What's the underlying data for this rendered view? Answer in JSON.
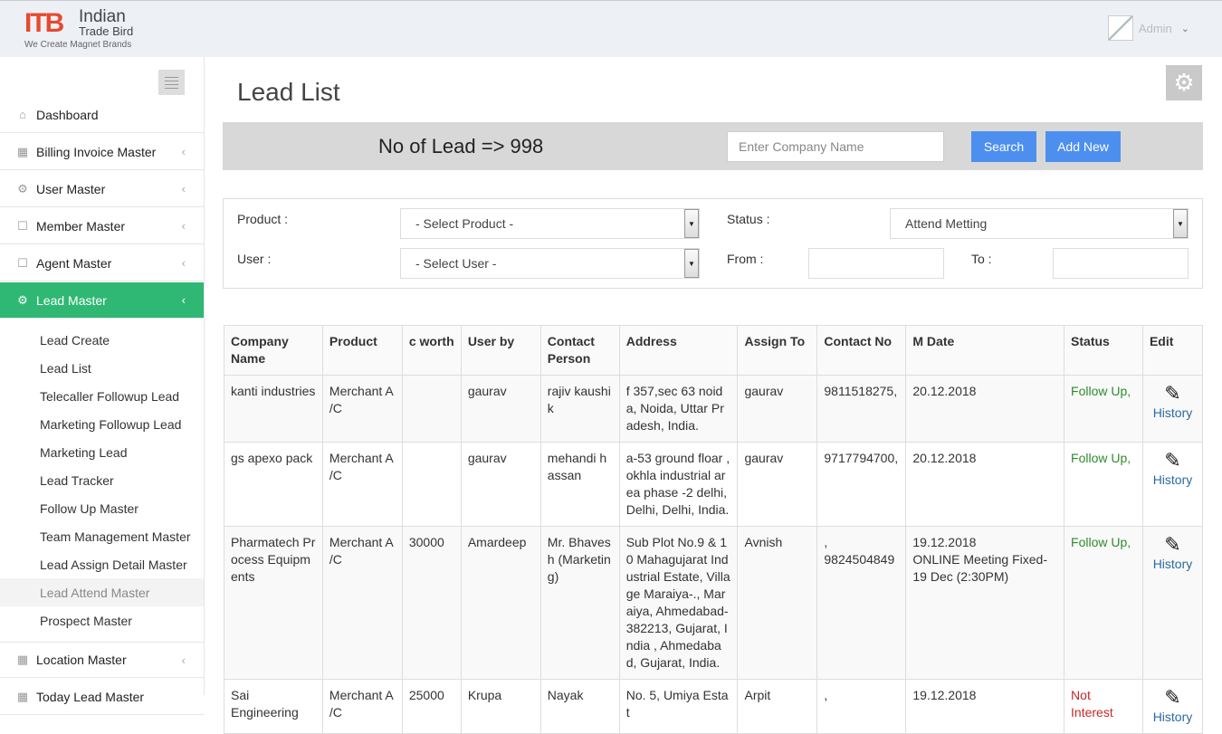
{
  "brand": {
    "mark": "ITB",
    "name": "Indian",
    "name2": "Trade Bird",
    "tagline": "We Create Magnet Brands"
  },
  "user": {
    "name": "Admin"
  },
  "sidebar": {
    "items": [
      {
        "label": "Dashboard",
        "icon": "home-icon"
      },
      {
        "label": "Billing Invoice Master",
        "icon": "table-icon"
      },
      {
        "label": "User Master",
        "icon": "cogs-icon"
      },
      {
        "label": "Member Master",
        "icon": "bookmark-icon"
      },
      {
        "label": "Agent Master",
        "icon": "bookmark-icon"
      },
      {
        "label": "Lead Master",
        "icon": "cogs-icon"
      },
      {
        "label": "Location Master",
        "icon": "table-icon"
      },
      {
        "label": "Today Lead Master",
        "icon": "table-icon"
      }
    ],
    "lead_sub": [
      "Lead Create",
      "Lead List",
      "Telecaller Followup Lead",
      "Marketing Followup Lead",
      "Marketing Lead",
      "Lead Tracker",
      "Follow Up Master",
      "Team Management Master",
      "Lead Assign Detail Master",
      "Lead Attend Master",
      "Prospect Master"
    ]
  },
  "page": {
    "title": "Lead List"
  },
  "leadbar": {
    "count_text": "No of Lead => 998",
    "search_placeholder": "Enter Company Name",
    "search_label": "Search",
    "add_label": "Add New"
  },
  "filters": {
    "product_label": "Product :",
    "product_value": "- Select Product -",
    "status_label": "Status :",
    "status_value": "Attend Metting",
    "user_label": "User :",
    "user_value": "- Select User -",
    "from_label": "From :",
    "to_label": "To :"
  },
  "table": {
    "headers": [
      "Company Name",
      "Product",
      "c worth",
      "User by",
      "Contact Person",
      "Address",
      "Assign To",
      "Contact No",
      "M Date",
      "Status",
      "Edit"
    ],
    "rows": [
      {
        "company": "kanti industries",
        "product": "Merchant A /C",
        "worth": "",
        "user": "gaurav",
        "contact": "rajiv kaushik",
        "address": "f 357,sec 63 noida, Noida, Uttar Pradesh, India.",
        "assign": "gaurav",
        "phone": "9811518275,",
        "mdate": "20.12.2018",
        "mnote": "",
        "status": "Follow Up,",
        "history": "History"
      },
      {
        "company": "gs apexo pack",
        "product": "Merchant A /C",
        "worth": "",
        "user": "gaurav",
        "contact": "mehandi hassan",
        "address": "a-53 ground floar ,okhla industrial area phase -2 delhi, Delhi, Delhi, India.",
        "assign": "gaurav",
        "phone": "9717794700,",
        "mdate": "20.12.2018",
        "mnote": "",
        "status": "Follow Up,",
        "history": "History"
      },
      {
        "company": "Pharmatech Process Equipments",
        "product": "Merchant A /C",
        "worth": "30000",
        "user": "Amardeep",
        "contact": "Mr. Bhavesh (Marketing)",
        "address": "Sub Plot No.9 & 10 Mahagujarat Industrial Estate, Village Maraiya-., Maraiya, Ahmedabad-382213, Gujarat, India , Ahmedabad, Gujarat, India.",
        "assign": "Avnish",
        "phone": ", 9824504849",
        "mdate": "19.12.2018",
        "mnote": "ONLINE Meeting Fixed-19 Dec (2:30PM)",
        "status": "Follow Up,",
        "history": "History"
      },
      {
        "company": "Sai Engineering",
        "product": "Merchant A /C",
        "worth": "25000",
        "user": "Krupa",
        "contact": "Nayak",
        "address": "No. 5, Umiya Estat",
        "assign": "Arpit",
        "phone": ",",
        "mdate": "19.12.2018",
        "mnote": "",
        "status": "Not Interest",
        "history": "History"
      }
    ]
  }
}
